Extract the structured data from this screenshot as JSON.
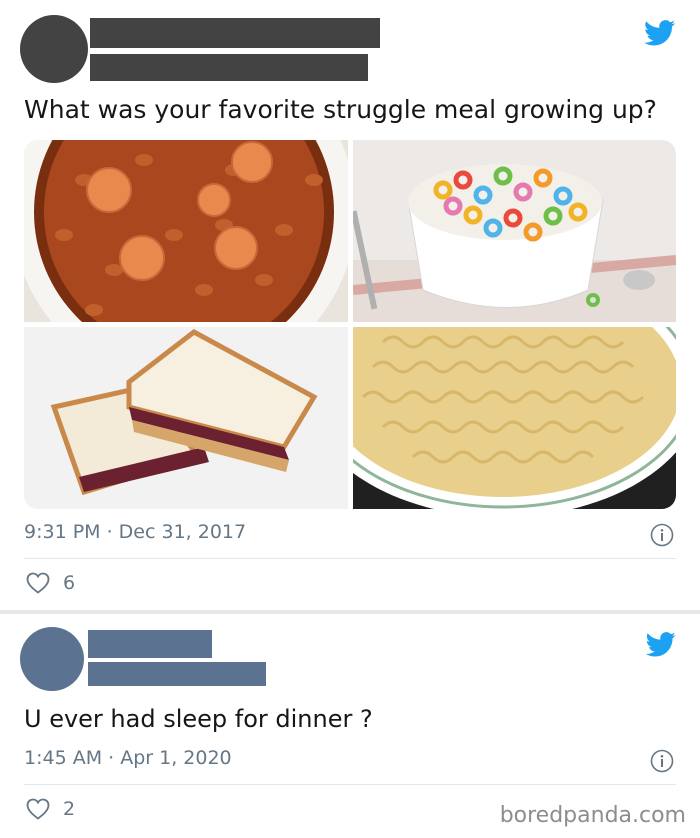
{
  "tweet1": {
    "text": "What was your favorite struggle meal growing up?",
    "date_time": "9:31 PM · Dec 31, 2017",
    "likes": "6",
    "images": [
      {
        "icon": "beans-and-franks-photo"
      },
      {
        "icon": "fruit-loops-cereal-photo"
      },
      {
        "icon": "pbj-sandwich-photo"
      },
      {
        "icon": "ramen-noodles-photo"
      }
    ]
  },
  "tweet2": {
    "text": "U ever had sleep for dinner ?",
    "date_time": "1:45 AM · Apr 1, 2020",
    "likes": "2"
  },
  "watermark": "boredpanda.com",
  "colors": {
    "twitter_blue": "#1da1f2",
    "avatar1": "#434343",
    "avatar2": "#5b7391",
    "meta_gray": "#657786"
  }
}
